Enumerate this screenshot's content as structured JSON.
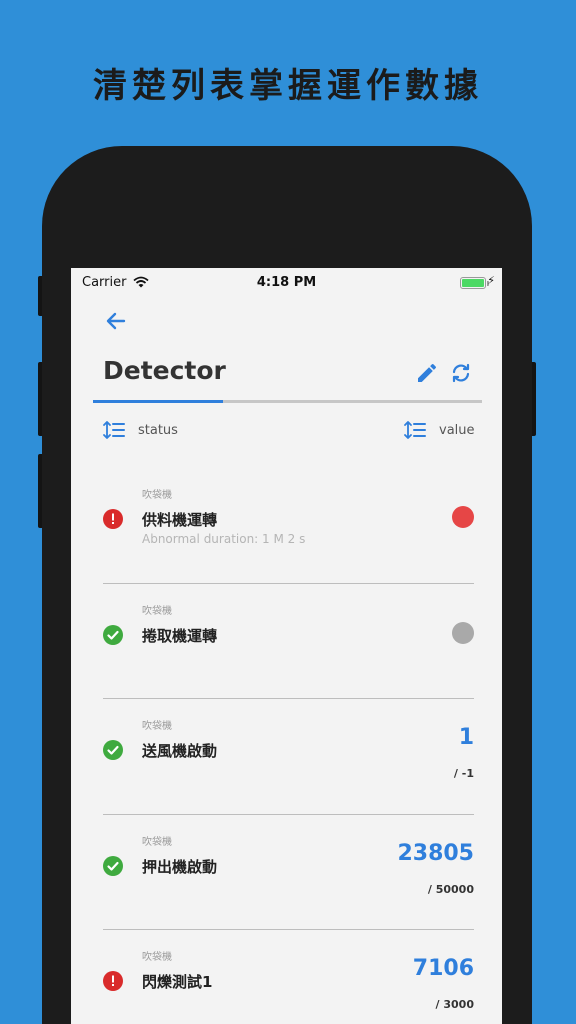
{
  "promo": {
    "title": "清楚列表掌握運作數據"
  },
  "status_bar": {
    "carrier": "Carrier",
    "time": "4:18 PM",
    "battery_color": "#4cd964"
  },
  "header": {
    "title": "Detector"
  },
  "sort": {
    "status_label": "status",
    "value_label": "value"
  },
  "colors": {
    "accent": "#2f7fdc",
    "background": "#2f8fd8",
    "error": "#d92b2b",
    "ok": "#3faa3f",
    "dot_red": "#e64646",
    "dot_gray": "#a9a9a9"
  },
  "items": [
    {
      "category": "吹袋機",
      "name": "供料機運轉",
      "status": "error",
      "detail": "Abnormal duration: 1 M 2 s",
      "indicator": "red-dot",
      "value": "",
      "target": ""
    },
    {
      "category": "吹袋機",
      "name": "捲取機運轉",
      "status": "ok",
      "detail": "",
      "indicator": "gray-dot",
      "value": "",
      "target": ""
    },
    {
      "category": "吹袋機",
      "name": "送風機啟動",
      "status": "ok",
      "detail": "",
      "indicator": "",
      "value": "1",
      "target": "/ -1"
    },
    {
      "category": "吹袋機",
      "name": "押出機啟動",
      "status": "ok",
      "detail": "",
      "indicator": "",
      "value": "23805",
      "target": "/ 50000"
    },
    {
      "category": "吹袋機",
      "name": "閃爍測試1",
      "status": "error",
      "detail": "",
      "indicator": "",
      "value": "7106",
      "target": "/ 3000"
    }
  ]
}
